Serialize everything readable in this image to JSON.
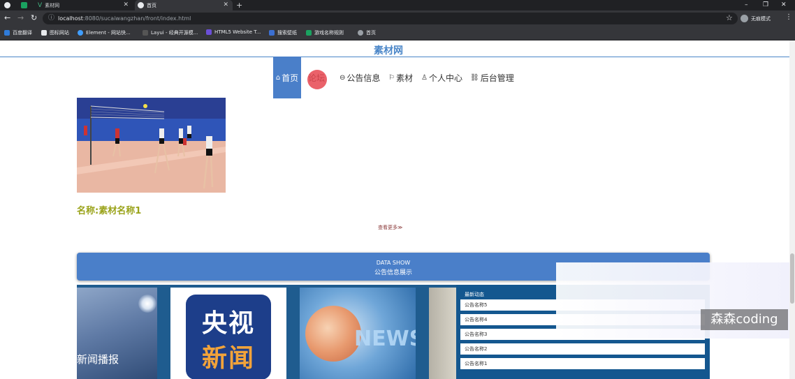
{
  "browser": {
    "tabs": [
      {
        "label": ""
      },
      {
        "label": ""
      },
      {
        "label": "素材网"
      },
      {
        "label": "首页"
      }
    ],
    "new_tab": "+",
    "window_controls": [
      "–",
      "❐",
      "✕"
    ],
    "url_host": "localhost",
    "url_rest": ":8080/sucaiwangzhan/front/index.html",
    "profile_label": "无痕模式",
    "bookmarks": [
      {
        "label": "百度翻译",
        "color": "#2f7bd9"
      },
      {
        "label": "图标网站",
        "color": "#e8eaed"
      },
      {
        "label": "Element - 网站快...",
        "color": "#409eff"
      },
      {
        "label": "Layui - 经典开源模...",
        "color": "#555555"
      },
      {
        "label": "HTML5 Website T...",
        "color": "#6b4fd8"
      },
      {
        "label": "搜索壁纸",
        "color": "#3b6fd1"
      },
      {
        "label": "游戏名称规则",
        "color": "#1aa260"
      },
      {
        "label": "首页",
        "color": "#9aa0a6"
      }
    ]
  },
  "site": {
    "title": "素材网",
    "nav": [
      {
        "label": "首页",
        "icon": "home-icon",
        "glyph": "⌂"
      },
      {
        "label": "论坛",
        "icon": "forum-icon",
        "glyph": ""
      },
      {
        "label": "公告信息",
        "icon": "notice-icon",
        "glyph": "⊖"
      },
      {
        "label": "素材",
        "icon": "flag-icon",
        "glyph": "⚐"
      },
      {
        "label": "个人中心",
        "icon": "user-icon",
        "glyph": "♙"
      },
      {
        "label": "后台管理",
        "icon": "link-icon",
        "glyph": "🔗"
      }
    ],
    "product": {
      "name": "名称:素材名称1"
    },
    "more_label": "查看更多≫",
    "datashow": {
      "title": "DATA SHOW",
      "subtitle": "公告信息展示"
    },
    "news_cards": [
      {
        "caption": "新闻播报"
      },
      {
        "caption_line1": "央视",
        "caption_line2": "新闻"
      },
      {
        "caption": "NEWS"
      }
    ],
    "news_panel": {
      "heading": "最新动态",
      "items": [
        "公告名称5",
        "公告名称4",
        "公告名称3",
        "公告名称2",
        "公告名称1"
      ]
    }
  },
  "watermark": "森森coding",
  "colors": {
    "brand": "#4a7fc9",
    "product_name": "#9aa31a",
    "news_band": "#1f5c8f"
  }
}
